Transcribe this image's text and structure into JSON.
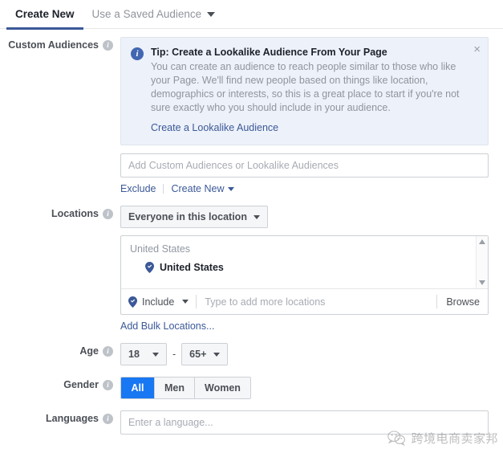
{
  "tabs": [
    {
      "label": "Create New",
      "active": true,
      "has_caret": false
    },
    {
      "label": "Use a Saved Audience",
      "active": false,
      "has_caret": true
    }
  ],
  "custom_audiences": {
    "label": "Custom Audiences",
    "tip": {
      "icon": "info-icon",
      "title": "Tip: Create a Lookalike Audience From Your Page",
      "body": "You can create an audience to reach people similar to those who like your Page. We'll find new people based on things like location, demographics or interests, so this is a great place to start if you're not sure exactly who you should include in your audience.",
      "link": "Create a Lookalike Audience",
      "close": "×"
    },
    "input_placeholder": "Add Custom Audiences or Lookalike Audiences",
    "input_value": "",
    "exclude_link": "Exclude",
    "create_new_link": "Create New"
  },
  "locations": {
    "label": "Locations",
    "scope_select": "Everyone in this location",
    "group_header": "United States",
    "items": [
      {
        "name": "United States",
        "icon": "location-pin-icon"
      }
    ],
    "include_select": "Include",
    "typeahead_placeholder": "Type to add more locations",
    "typeahead_value": "",
    "browse_label": "Browse",
    "bulk_link": "Add Bulk Locations..."
  },
  "age": {
    "label": "Age",
    "min": "18",
    "max": "65+",
    "separator": "-"
  },
  "gender": {
    "label": "Gender",
    "options": [
      {
        "label": "All",
        "selected": true
      },
      {
        "label": "Men",
        "selected": false
      },
      {
        "label": "Women",
        "selected": false
      }
    ]
  },
  "languages": {
    "label": "Languages",
    "placeholder": "Enter a language...",
    "value": ""
  },
  "watermark": {
    "text": "跨境电商卖家邦",
    "icon": "wechat-icon"
  },
  "colors": {
    "tab_active_underline": "#3b5998",
    "link": "#3b5998",
    "gender_selected": "#1877f2",
    "tip_bg": "#edf1f9",
    "tip_border": "#dfe3ee",
    "pin": "#3b5998"
  }
}
